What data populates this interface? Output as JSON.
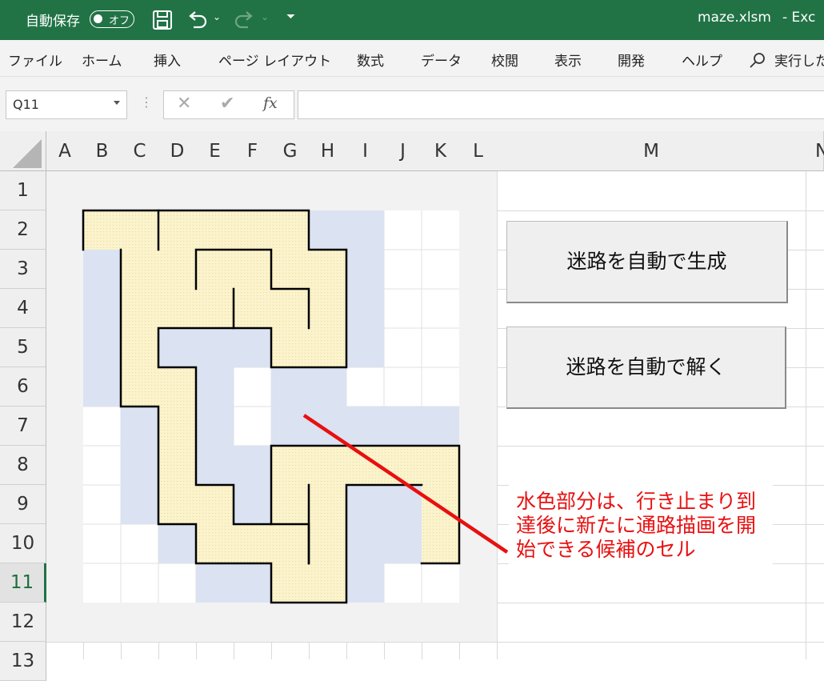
{
  "titlebar": {
    "autosave_label": "自動保存",
    "autosave_state": "オフ",
    "filename": "maze.xlsm",
    "app": "-  Exc"
  },
  "menu": {
    "items": [
      "ファイル",
      "ホーム",
      "挿入",
      "ページ レイアウト",
      "数式",
      "データ",
      "校閲",
      "表示",
      "開発",
      "ヘルプ"
    ],
    "search": "実行した"
  },
  "formula_bar": {
    "name_box": "Q11",
    "fx": "fx",
    "formula": ""
  },
  "columns": [
    "A",
    "B",
    "C",
    "D",
    "E",
    "F",
    "G",
    "H",
    "I",
    "J",
    "K",
    "L",
    "M",
    "N"
  ],
  "rows": [
    "1",
    "2",
    "3",
    "4",
    "5",
    "6",
    "7",
    "8",
    "9",
    "10",
    "11",
    "12",
    "13"
  ],
  "buttons": {
    "generate": "迷路を自動で生成",
    "solve": "迷路を自動で解く"
  },
  "annotation": "水色部分は、行き止まり到達後に新たに通路描画を開始できる候補のセル",
  "colors": {
    "excel_green": "#217346",
    "path": "#fbf3cc",
    "candidate": "#dbe2f2",
    "frame": "#f2f2f2",
    "note": "#e81010"
  }
}
